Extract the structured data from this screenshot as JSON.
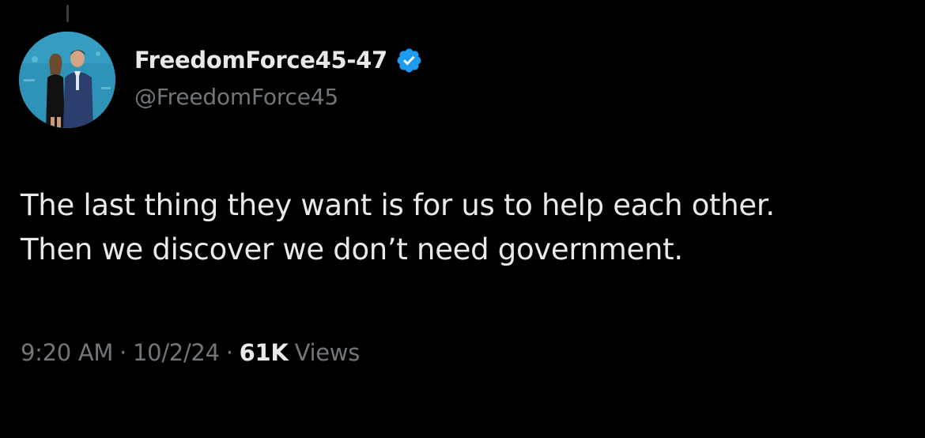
{
  "tweet": {
    "author": {
      "display_name": "FreedomForce45-47",
      "handle": "@FreedomForce45",
      "verified": true,
      "verified_icon": "verified-badge-icon",
      "avatar": "profile-photo"
    },
    "text_lines": [
      "The last thing they want is for us to help each other.",
      "Then we discover we don’t need government."
    ],
    "meta": {
      "time": "9:20 AM",
      "date": "10/2/24",
      "separator": "·",
      "views_count": "61K",
      "views_label": "Views"
    }
  },
  "colors": {
    "background": "#000000",
    "primary_text": "#e7e9ea",
    "secondary_text": "#71767b",
    "verified_blue": "#1d9bf0"
  }
}
